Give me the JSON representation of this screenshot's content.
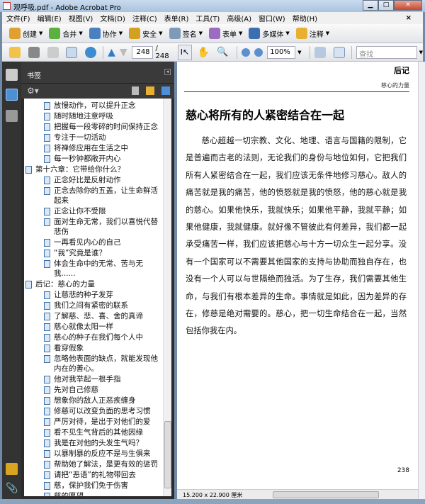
{
  "window": {
    "title": "观呼吸.pdf - Adobe Acrobat Pro"
  },
  "menu": [
    "文件(F)",
    "编辑(E)",
    "视图(V)",
    "文档(D)",
    "注释(C)",
    "表单(R)",
    "工具(T)",
    "高级(A)",
    "窗口(W)",
    "帮助(H)"
  ],
  "menu_close": "×",
  "toolbar1": [
    {
      "label": "创建",
      "color": "#e0a030"
    },
    {
      "label": "合并",
      "color": "#5bb040"
    },
    {
      "label": "协作",
      "color": "#4a7fc0"
    },
    {
      "label": "安全",
      "color": "#d4a020"
    },
    {
      "label": "签名",
      "color": "#7d9ab8"
    },
    {
      "label": "表单",
      "color": "#9b6cc0"
    },
    {
      "label": "多媒体",
      "color": "#3b6fb0"
    },
    {
      "label": "注释",
      "color": "#e8b030"
    }
  ],
  "toolbar2": {
    "page_current": "248",
    "page_total": "/ 248",
    "zoom": "100%",
    "find_placeholder": "查找"
  },
  "panel": {
    "title": "书签",
    "close": "◂"
  },
  "bookmarks": [
    {
      "label": "放慢动作，可以提升正念",
      "level": 2
    },
    {
      "label": "随时随地注意呼吸",
      "level": 2
    },
    {
      "label": "把握每一段零碎的时间保持正念",
      "level": 2
    },
    {
      "label": "专注于一切活动",
      "level": 2
    },
    {
      "label": "将禅修应用在生活之中",
      "level": 2
    },
    {
      "label": "每一秒钟都敞开内心",
      "level": 2
    },
    {
      "label": "第十六章：它带给你什么？",
      "level": 1
    },
    {
      "label": "正念好比是反射动作",
      "level": 2
    },
    {
      "label": "正念去除你的五盖，让生命鲜活起来",
      "level": 2
    },
    {
      "label": "正念让你不受限",
      "level": 2
    },
    {
      "label": "面对生命无常，我们以喜悦代替悲伤",
      "level": 2
    },
    {
      "label": "一再看见内心的自己",
      "level": 2
    },
    {
      "label": "“我”究竟是谁？",
      "level": 2
    },
    {
      "label": "体会生命中的无常、苦与无我......",
      "level": 2
    },
    {
      "label": "后记：慈心的力量",
      "level": 1
    },
    {
      "label": "让慈悲的种子发芽",
      "level": 2
    },
    {
      "label": "我们之间有紧密的联系",
      "level": 2
    },
    {
      "label": "了解慈、悲、喜、舍的真谛",
      "level": 2
    },
    {
      "label": "慈心就像太阳一样",
      "level": 2
    },
    {
      "label": "慈心的种子在我们每个人中",
      "level": 2
    },
    {
      "label": "看穿假象",
      "level": 2
    },
    {
      "label": "忽略他表面的缺点，就能发现他内在的善心。",
      "level": 2
    },
    {
      "label": "他对我举起一根手指",
      "level": 2
    },
    {
      "label": "先对自己修慈",
      "level": 2
    },
    {
      "label": "想象你的敌人正恶疾缠身",
      "level": 2
    },
    {
      "label": "修慈可以改变负面的思考习惯",
      "level": 2
    },
    {
      "label": "严厉对待，是出于对他们的爱",
      "level": 2
    },
    {
      "label": "看不见生气背后的其他因缘",
      "level": 2
    },
    {
      "label": "我是在对他的头发生气吗？",
      "level": 2
    },
    {
      "label": "以暴制暴的反应不是与生俱来",
      "level": 2
    },
    {
      "label": "帮助她了解法，是更有效的惩罚",
      "level": 2
    },
    {
      "label": "请把“恶语”的礼物带回去",
      "level": 2
    },
    {
      "label": "慈，保护我们免于伤害",
      "level": 2
    },
    {
      "label": "慈的愿望......",
      "level": 2
    },
    {
      "label": "慈心将所有的人紧密结合在一起",
      "level": 2,
      "selected": true
    }
  ],
  "document": {
    "running_head": "后记",
    "running_subhead": "慈心的力量",
    "heading": "慈心将所有的人紧密结合在一起",
    "body": "慈心超越一切宗教、文化、地理、语言与国籍的限制，它是普遍而古老的法则，无论我们的身份与地位如何，它把我们所有人紧密结合在一起，我们应该无条件地修习慈心。敌人的痛苦就是我的痛苦，他的愤怒就是我的愤怒，他的慈心就是我的慈心。如果他快乐，我就快乐；如果他平静，我就平静；如果他健康，我就健康。就好像不管彼此有何差异，我们都一起承受痛苦一样，我们应该把慈心与十方一切众生一起分享。没有一个国家可以不需要其他国家的支持与协助而独自存在，也没有一个人可以与世隔绝而独活。为了生存，我们需要其他生命，与我们有根本差异的生命。事情就是如此，因为差异的存在，修慈是绝对需要的。慈心，把一切生命结合在一起，当然包括你我在内。",
    "page_number": "238"
  },
  "status": {
    "page_size": "15.200 x 22.900 厘米"
  }
}
